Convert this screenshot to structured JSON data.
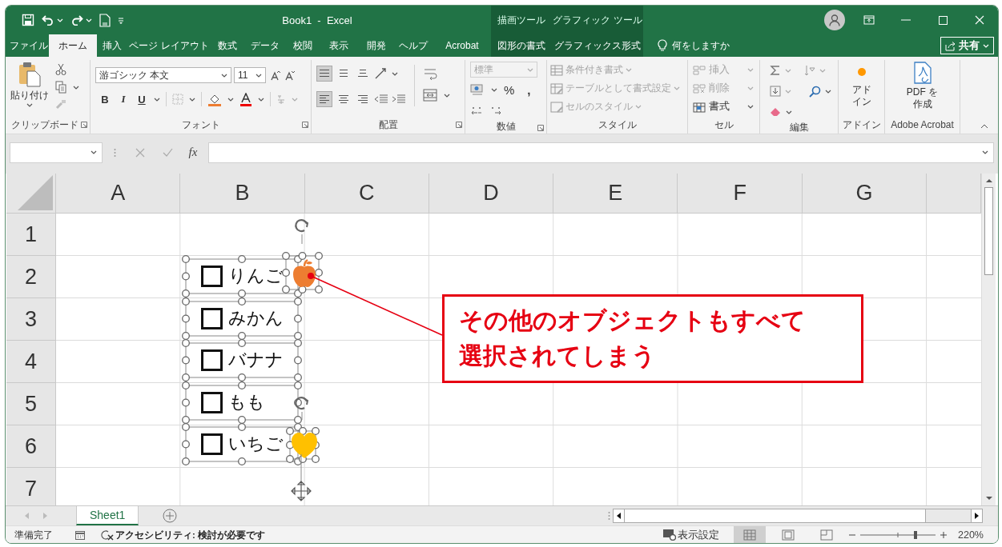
{
  "title_bar": {
    "title": "Book1  -  Excel",
    "context_groups": [
      {
        "label": "描画ツール"
      },
      {
        "label": "グラフィック ツール"
      }
    ]
  },
  "tabs": [
    {
      "label": "ファイル",
      "selected": false,
      "kind": "standard"
    },
    {
      "label": "ホーム",
      "selected": true,
      "kind": "standard"
    },
    {
      "label": "挿入",
      "selected": false,
      "kind": "standard"
    },
    {
      "label": "ページ レイアウト",
      "selected": false,
      "kind": "standard"
    },
    {
      "label": "数式",
      "selected": false,
      "kind": "standard"
    },
    {
      "label": "データ",
      "selected": false,
      "kind": "standard"
    },
    {
      "label": "校閲",
      "selected": false,
      "kind": "standard"
    },
    {
      "label": "表示",
      "selected": false,
      "kind": "standard"
    },
    {
      "label": "開発",
      "selected": false,
      "kind": "standard"
    },
    {
      "label": "ヘルプ",
      "selected": false,
      "kind": "standard"
    },
    {
      "label": "Acrobat",
      "selected": false,
      "kind": "standard"
    },
    {
      "label": "図形の書式",
      "selected": false,
      "kind": "contextual"
    },
    {
      "label": "グラフィックス形式",
      "selected": false,
      "kind": "contextual"
    }
  ],
  "tell_me": {
    "placeholder": "何をしますか"
  },
  "share_button": "共有",
  "ribbon": {
    "clipboard": {
      "label": "クリップボード",
      "paste": "貼り付け"
    },
    "font": {
      "label": "フォント",
      "font_name": "游ゴシック 本文",
      "font_size": "11",
      "bold": "B",
      "italic": "I",
      "underline": "U"
    },
    "alignment": {
      "label": "配置",
      "vertical_align": [
        {
          "kind": "top",
          "selected": true
        },
        {
          "kind": "middle",
          "selected": false
        },
        {
          "kind": "bottom",
          "selected": false
        }
      ],
      "horizontal_align": [
        {
          "kind": "left",
          "selected": true
        },
        {
          "kind": "center",
          "selected": false
        },
        {
          "kind": "right",
          "selected": false
        }
      ]
    },
    "number": {
      "label": "数値",
      "format": {
        "value": "標準",
        "disabled": true
      },
      "percent": "%",
      "comma": ","
    },
    "styles": {
      "label": "スタイル",
      "items": [
        {
          "kind": "conditional",
          "label": "条件付き書式",
          "disabled": true
        },
        {
          "kind": "table",
          "label": "テーブルとして書式設定",
          "disabled": true
        },
        {
          "kind": "cell_style",
          "label": "セルのスタイル",
          "disabled": true
        }
      ]
    },
    "cells": {
      "label": "セル",
      "items": [
        {
          "kind": "insert",
          "label": "挿入",
          "disabled": true
        },
        {
          "kind": "delete",
          "label": "削除",
          "disabled": true
        },
        {
          "kind": "format",
          "label": "書式",
          "disabled": false
        }
      ]
    },
    "editing": {
      "label": "編集"
    },
    "addin": {
      "label": "アドイン",
      "button": "アドイン"
    },
    "adobe": {
      "label": "Adobe Acrobat",
      "button": "PDF を作成"
    }
  },
  "formula_bar": {
    "function_label": "fx"
  },
  "sheet": {
    "columns": [
      "A",
      "B",
      "C",
      "D",
      "E",
      "F",
      "G"
    ],
    "rows": [
      "1",
      "2",
      "3",
      "4",
      "5",
      "6",
      "7"
    ],
    "checkboxes": [
      {
        "label": "りんご",
        "checked": false
      },
      {
        "label": "みかん",
        "checked": false
      },
      {
        "label": "バナナ",
        "checked": false
      },
      {
        "label": "もも",
        "checked": false
      },
      {
        "label": "いちご",
        "checked": false
      }
    ],
    "shapes": [
      {
        "kind": "apple",
        "color": "#ed7d31"
      },
      {
        "kind": "heart",
        "color": "#ffc000"
      }
    ],
    "callout": "その他のオブジェクトもすべて選択されてしまう"
  },
  "sheet_tabs": [
    {
      "label": "Sheet1",
      "selected": true
    }
  ],
  "status_bar": {
    "ready": "準備完了",
    "accessibility": "アクセシビリティ: 検討が必要です",
    "display_settings": "表示設定",
    "views": [
      {
        "kind": "normal",
        "selected": true
      },
      {
        "kind": "page_layout",
        "selected": false
      },
      {
        "kind": "page_break",
        "selected": false
      }
    ],
    "zoom": {
      "level": 0.73,
      "reading": "220%"
    }
  }
}
